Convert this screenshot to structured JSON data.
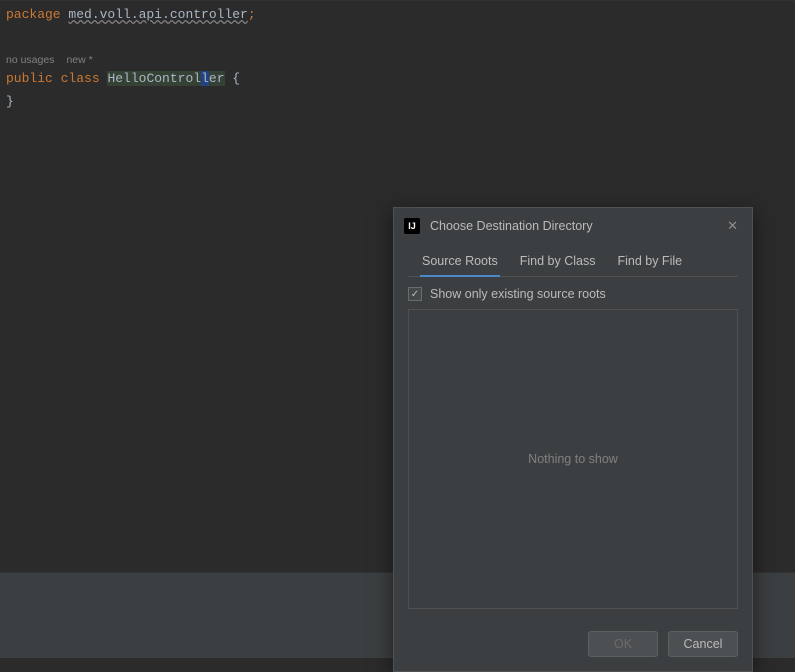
{
  "code": {
    "kw_package": "package",
    "pkg_name": "med.voll.api.controller",
    "semi": ";",
    "hint_usages": "no usages",
    "hint_new": "new *",
    "kw_public": "public",
    "kw_class": "class",
    "class_name_pre": "HelloControl",
    "class_name_cursor": "l",
    "class_name_post": "er",
    "brace_open": " {",
    "brace_close": "}"
  },
  "dialog": {
    "title": "Choose Destination Directory",
    "app_icon": "IJ",
    "tabs": {
      "source_roots": "Source Roots",
      "find_by_class": "Find by Class",
      "find_by_file": "Find by File"
    },
    "checkbox_label": "Show only existing source roots",
    "empty_text": "Nothing to show",
    "ok": "OK",
    "cancel": "Cancel"
  }
}
